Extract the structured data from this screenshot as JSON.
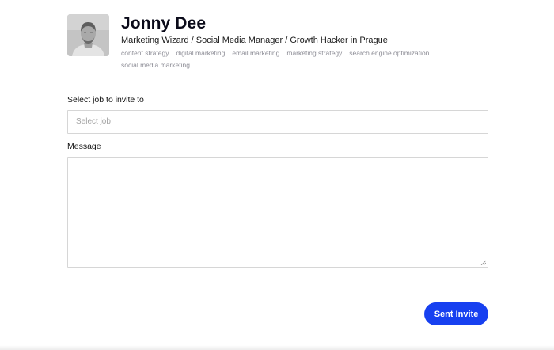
{
  "profile": {
    "avatar_icon": "person-portrait-icon",
    "name": "Jonny Dee",
    "headline": "Marketing Wizard / Social Media Manager / Growth Hacker in Prague",
    "tags": [
      "content strategy",
      "digital marketing",
      "email marketing",
      "marketing strategy",
      "search engine optimization",
      "social media marketing"
    ]
  },
  "form": {
    "job_label": "Select job to invite to",
    "job_placeholder": "Select job",
    "message_label": "Message",
    "message_value": "",
    "submit_label": "Sent Invite"
  },
  "colors": {
    "accent": "#1740f0",
    "tag_text": "#8d8d96",
    "border": "#d6d6d6"
  }
}
